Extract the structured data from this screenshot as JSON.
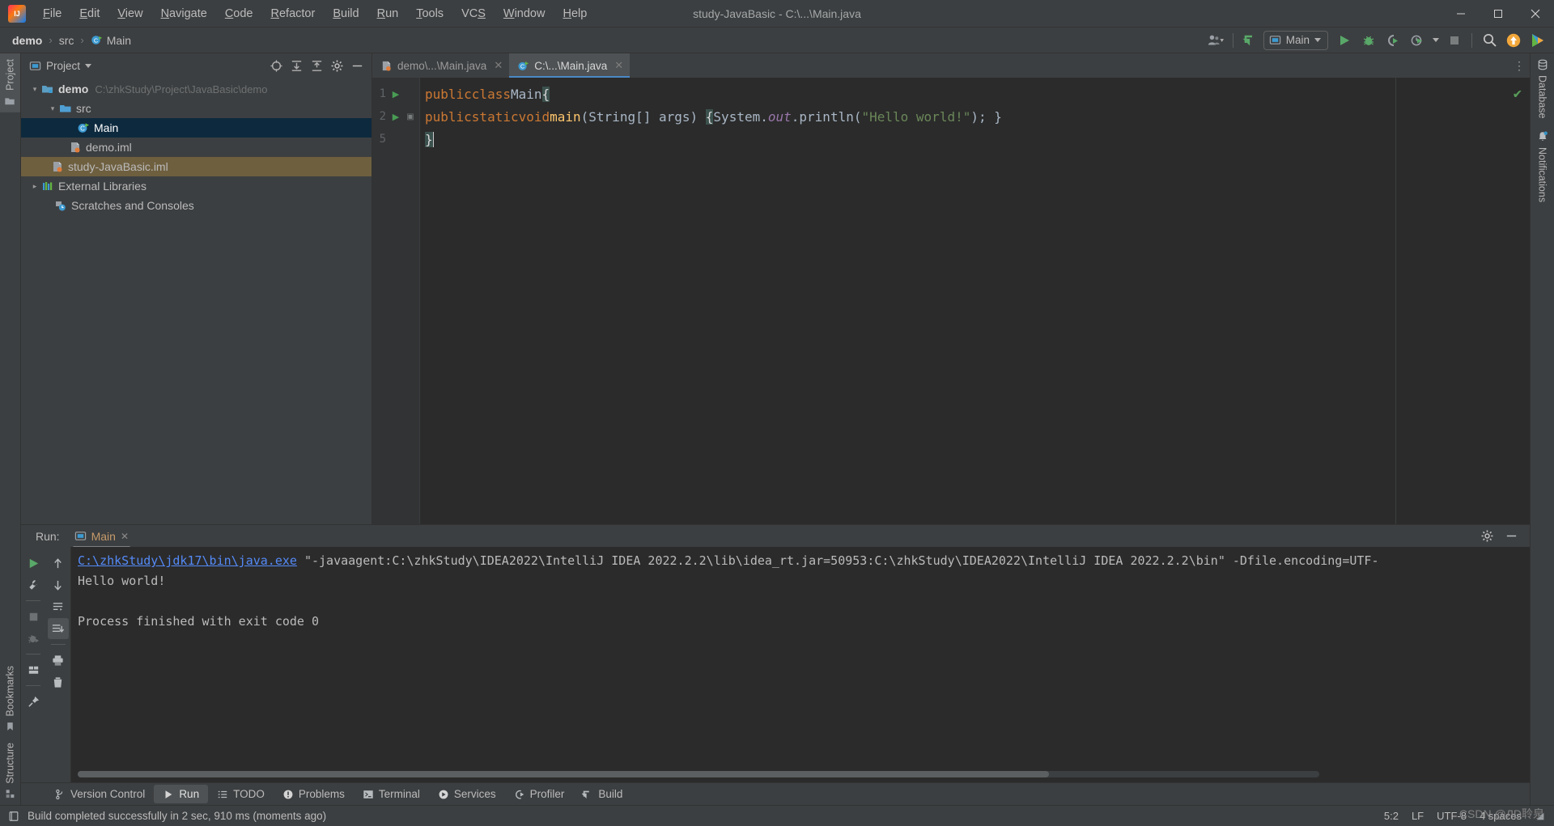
{
  "window": {
    "title": "study-JavaBasic - C:\\...\\Main.java",
    "minimize": "–",
    "maximize": "❐",
    "close": "✕"
  },
  "menu": {
    "items": [
      {
        "label": "File",
        "mnemonic": "F",
        "rest": "ile"
      },
      {
        "label": "Edit",
        "mnemonic": "E",
        "rest": "dit"
      },
      {
        "label": "View",
        "mnemonic": "V",
        "rest": "iew"
      },
      {
        "label": "Navigate",
        "mnemonic": "N",
        "rest": "avigate"
      },
      {
        "label": "Code",
        "mnemonic": "C",
        "rest": "ode"
      },
      {
        "label": "Refactor",
        "mnemonic": "R",
        "rest": "efactor"
      },
      {
        "label": "Build",
        "mnemonic": "B",
        "rest": "uild"
      },
      {
        "label": "Run",
        "mnemonic": "R",
        "rest": "un"
      },
      {
        "label": "Tools",
        "mnemonic": "T",
        "rest": "ools"
      },
      {
        "label": "VCS",
        "mnemonic": "S",
        "rest": "VC"
      },
      {
        "label": "Window",
        "mnemonic": "W",
        "rest": "indow"
      },
      {
        "label": "Help",
        "mnemonic": "H",
        "rest": "elp"
      }
    ]
  },
  "breadcrumb": {
    "items": [
      "demo",
      "src",
      "Main"
    ],
    "sep": "›"
  },
  "toolbar": {
    "run_config": "Main",
    "icons": {
      "account": "account-icon",
      "vcs_update": "vcs-update-icon",
      "run": "run-icon",
      "debug": "debug-icon",
      "run_coverage": "run-with-coverage-icon",
      "profiler": "profiler-icon",
      "stop": "stop-icon",
      "search": "search-everywhere-icon",
      "update": "ide-update-icon",
      "services": "ide-services-icon"
    }
  },
  "project_panel": {
    "title": "Project",
    "actions": [
      "select-opened-file-icon",
      "expand-all-icon",
      "collapse-all-icon",
      "settings-icon",
      "hide-icon"
    ],
    "tree": [
      {
        "label": "demo",
        "path": "C:\\zhkStudy\\Project\\JavaBasic\\demo",
        "icon": "module-icon",
        "indent": 0,
        "arrow": "down",
        "bold": true,
        "state": "normal"
      },
      {
        "label": "src",
        "path": "",
        "icon": "source-folder-icon",
        "indent": 1,
        "arrow": "down",
        "bold": false,
        "state": "normal"
      },
      {
        "label": "Main",
        "path": "",
        "icon": "java-class-run-icon",
        "indent": 2,
        "arrow": "none",
        "bold": false,
        "state": "selected"
      },
      {
        "label": "demo.iml",
        "path": "",
        "icon": "iml-file-icon",
        "indent": 1,
        "arrow": "none",
        "bold": false,
        "state": "normal"
      },
      {
        "label": "study-JavaBasic.iml",
        "path": "",
        "icon": "iml-file-icon",
        "indent": 0,
        "arrow": "none",
        "bold": false,
        "state": "highlight"
      },
      {
        "label": "External Libraries",
        "path": "",
        "icon": "libraries-icon",
        "indent": 0,
        "arrow": "right",
        "bold": false,
        "state": "normal"
      },
      {
        "label": "Scratches and Consoles",
        "path": "",
        "icon": "scratches-icon",
        "indent": 0,
        "arrow": "none",
        "bold": false,
        "state": "normal"
      }
    ]
  },
  "editor": {
    "tabs": [
      {
        "label": "demo\\...\\Main.java",
        "icon": "iml-file-icon",
        "active": false,
        "close": "✕"
      },
      {
        "label": "C:\\...\\Main.java",
        "icon": "java-class-run-icon",
        "active": true,
        "close": "✕"
      }
    ],
    "more": "⋮",
    "lines": [
      {
        "number": "1",
        "gutter_run": true,
        "fold": false
      },
      {
        "number": "2",
        "gutter_run": true,
        "fold": true
      },
      {
        "number": "5",
        "gutter_run": false,
        "fold": false
      }
    ],
    "code": {
      "l1": {
        "kw1": "public",
        "kw2": "class",
        "name": "Main",
        "brace": "{"
      },
      "l2": {
        "kw1": "public",
        "kw2": "static",
        "kw3": "void",
        "name": "main",
        "sig": "(String[] args) ",
        "open": "{",
        "sys": "System.",
        "out": "out",
        "dot": ".",
        "println": "println",
        "p1": "(",
        "str": "\"Hello world!\"",
        "p2": ");",
        "close": " }"
      },
      "l5": {
        "brace": "}"
      }
    },
    "inspection_status": "✔"
  },
  "run_panel": {
    "label": "Run:",
    "tab": "Main",
    "tab_close": "✕",
    "header_actions": [
      "settings-icon",
      "hide-icon"
    ],
    "left_toolbar": [
      "rerun-icon",
      "edit-configuration-icon",
      "stop-icon",
      "rerun-failed-icon",
      "layout-icon",
      "pin-tab-icon"
    ],
    "second_toolbar": [
      "up-icon",
      "down-icon",
      "soft-wrap-icon",
      "scroll-to-end-icon",
      "print-icon",
      "clear-all-icon"
    ],
    "console": [
      {
        "link": "C:\\zhkStudy\\jdk17\\bin\\java.exe",
        "rest": " \"-javaagent:C:\\zhkStudy\\IDEA2022\\IntelliJ IDEA 2022.2.2\\lib\\idea_rt.jar=50953:C:\\zhkStudy\\IDEA2022\\IntelliJ IDEA 2022.2.2\\bin\" -Dfile.encoding=UTF-"
      },
      {
        "link": "",
        "rest": "Hello world!"
      },
      {
        "link": "",
        "rest": ""
      },
      {
        "link": "",
        "rest": "Process finished with exit code 0"
      }
    ]
  },
  "rails": {
    "left_top": [
      {
        "label": "Project",
        "icon": "project-folder-icon",
        "selected": true
      }
    ],
    "left_bottom": [
      {
        "label": "Bookmarks",
        "icon": "bookmark-icon",
        "selected": false
      },
      {
        "label": "Structure",
        "icon": "structure-icon",
        "selected": false
      }
    ],
    "right": [
      {
        "label": "Database",
        "icon": "database-icon",
        "selected": false
      },
      {
        "label": "Notifications",
        "icon": "notifications-icon",
        "selected": false
      }
    ]
  },
  "bottom_bar": {
    "tabs": [
      {
        "label": "Version Control",
        "icon": "vcs-branch-icon",
        "selected": false
      },
      {
        "label": "Run",
        "icon": "run-icon",
        "selected": true
      },
      {
        "label": "TODO",
        "icon": "todo-icon",
        "selected": false
      },
      {
        "label": "Problems",
        "icon": "problems-icon",
        "selected": false
      },
      {
        "label": "Terminal",
        "icon": "terminal-icon",
        "selected": false
      },
      {
        "label": "Services",
        "icon": "services-icon",
        "selected": false
      },
      {
        "label": "Profiler",
        "icon": "profiler-icon",
        "selected": false
      },
      {
        "label": "Build",
        "icon": "build-icon",
        "selected": false
      }
    ]
  },
  "status_bar": {
    "message": "Build completed successfully in 2 sec, 910 ms (moments ago)",
    "caret": "5:2",
    "line_sep": "LF",
    "encoding": "UTF-8",
    "indent": "4 spaces",
    "watermark": "CSDN @ЛD聆泉"
  }
}
